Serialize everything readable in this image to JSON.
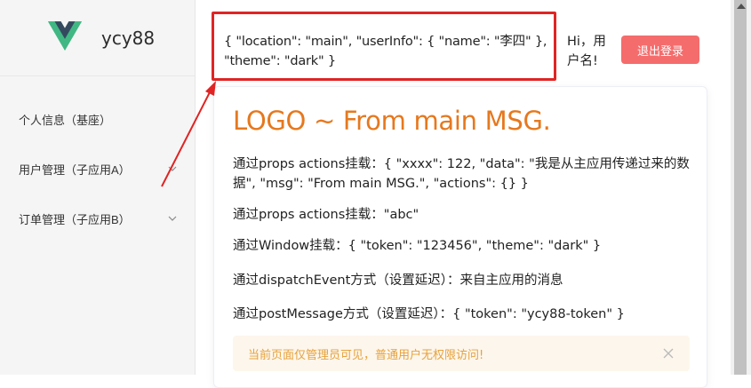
{
  "brand": {
    "name": "ycy88",
    "logo_icon": "vue-logo-icon"
  },
  "sidebar": {
    "items": [
      {
        "label": "个人信息（基座）",
        "has_submenu": false
      },
      {
        "label": "用户管理（子应用A）",
        "has_submenu": true
      },
      {
        "label": "订单管理（子应用B）",
        "has_submenu": true
      }
    ]
  },
  "header": {
    "props_json_line1": "{ \"location\": \"main\", \"userInfo\": { \"name\": \"李四\" },",
    "props_json_line2": "\"theme\": \"dark\" }",
    "greeting_line1": "Hi，用",
    "greeting_line2": "户名!",
    "logout_label": "退出登录"
  },
  "main": {
    "title": "LOGO ~ From main MSG.",
    "lines": [
      "通过props actions挂载：{ \"xxxx\": 122, \"data\": \"我是从主应用传递过来的数据\", \"msg\": \"From main MSG.\", \"actions\": {} }",
      "通过props actions挂载：\"abc\"",
      "通过Window挂载：{ \"token\": \"123456\", \"theme\": \"dark\" }",
      "通过dispatchEvent方式（设置延迟）：来自主应用的消息",
      "通过postMessage方式（设置延迟）：{ \"token\": \"ycy88-token\" }"
    ],
    "alert_text": "当前页面仅管理员可见，普通用户无权限访问!"
  },
  "colors": {
    "accent_orange": "#e6781e",
    "logout_red": "#f56c6c",
    "highlight_red": "#e02424",
    "alert_bg": "#fdf6ec",
    "alert_text": "#e6a23c",
    "vue_green": "#41b883",
    "vue_dark": "#35495e"
  }
}
